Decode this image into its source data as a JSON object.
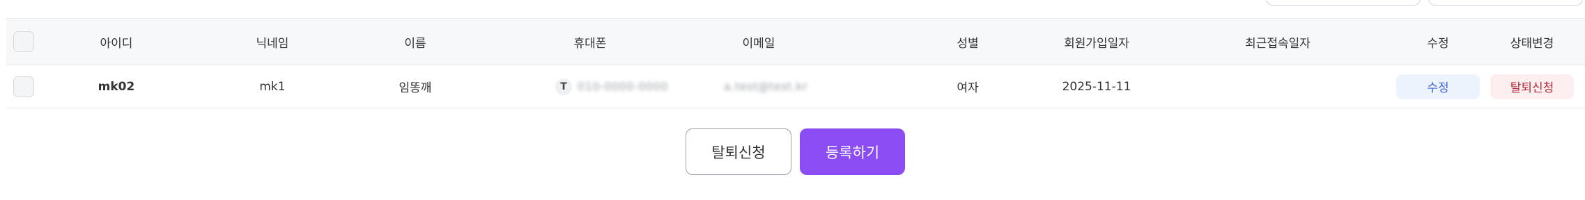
{
  "table": {
    "headers": {
      "id": "아이디",
      "nickname": "닉네임",
      "name": "이름",
      "phone": "휴대폰",
      "email": "이메일",
      "gender": "성별",
      "join_date": "회원가입일자",
      "last_login": "최근접속일자",
      "edit": "수정",
      "status_change": "상태변경"
    },
    "rows": [
      {
        "id": "mk02",
        "nickname": "mk1",
        "name": "임똥깨",
        "phone_prefix": "T",
        "phone": "010-0000-0000",
        "email": "a.test@test.kr",
        "gender": "여자",
        "join_date": "2025-11-11",
        "last_login": "",
        "edit_label": "수정",
        "withdraw_label": "탈퇴신청"
      }
    ]
  },
  "actions": {
    "withdraw_label": "탈퇴신청",
    "register_label": "등록하기"
  },
  "colors": {
    "primary": "#8b4cf4",
    "edit_pill_bg": "#edf3fd",
    "edit_pill_text": "#3d61d6",
    "withdraw_pill_bg": "#fdeef0",
    "withdraw_pill_text": "#b32b3a"
  }
}
